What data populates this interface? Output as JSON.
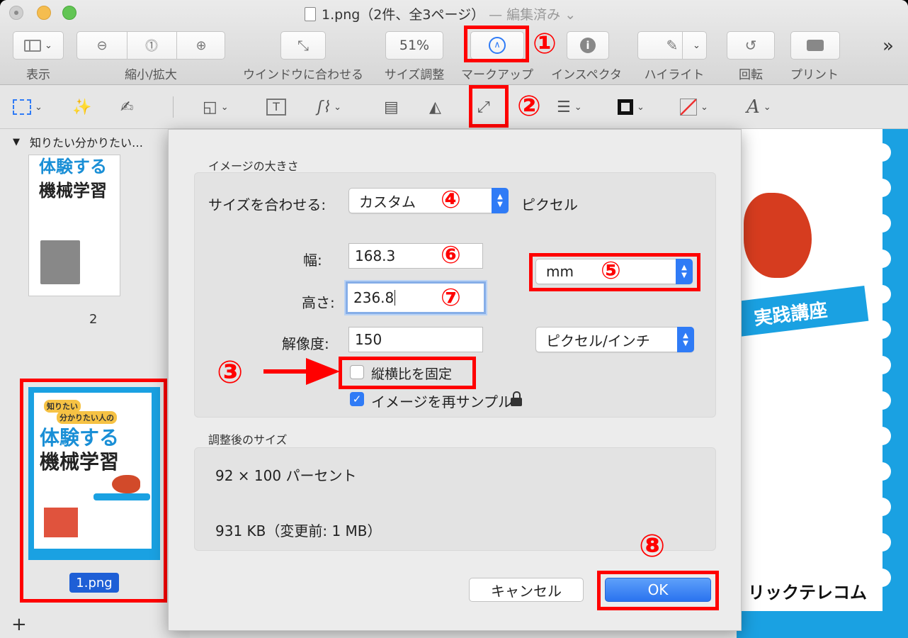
{
  "window": {
    "title": "1.png（2件、全3ページ）",
    "edited": "— 編集済み ⌄"
  },
  "toolbar": {
    "view_label": "表示",
    "zoom_label": "縮小/拡大",
    "fit_label": "ウインドウに合わせる",
    "zoom_value": "51%",
    "size_label": "サイズ調整",
    "markup_label": "マークアップ",
    "inspector_label": "インスペクタ",
    "highlight_label": "ハイライト",
    "rotate_label": "回転",
    "print_label": "プリント",
    "more": "»"
  },
  "annotations": {
    "n1": "①",
    "n2": "②",
    "n3": "③",
    "n4": "④",
    "n5": "⑤",
    "n6": "⑥",
    "n7": "⑦",
    "n8": "⑧"
  },
  "sidebar": {
    "header": "知りたい分かりたい…",
    "thumb1_title": "体験する",
    "thumb1_title2": "機械学習",
    "page2_label": "2",
    "thumb2_line1": "知りたい",
    "thumb2_line2": "分かりたい人の",
    "thumb2_title": "体験する",
    "thumb2_title2": "機械学習",
    "selected_label": "1.png"
  },
  "document": {
    "banner": "実践講座",
    "publisher": "リックテレコム"
  },
  "dialog": {
    "image_size_title": "イメージの大きさ",
    "fit_label": "サイズを合わせる:",
    "fit_value": "カスタム",
    "pixel_label": "ピクセル",
    "width_label": "幅:",
    "width_value": "168.3",
    "height_label": "高さ:",
    "height_value": "236.8",
    "resolution_label": "解像度:",
    "resolution_value": "150",
    "unit_value": "mm",
    "res_unit_value": "ピクセル/インチ",
    "aspect_label": "縦横比を固定",
    "resample_label": "イメージを再サンプル",
    "result_title": "調整後のサイズ",
    "result_percent": "92 × 100 パーセント",
    "result_size": "931 KB（変更前: 1 MB）",
    "cancel_label": "キャンセル",
    "ok_label": "OK"
  }
}
